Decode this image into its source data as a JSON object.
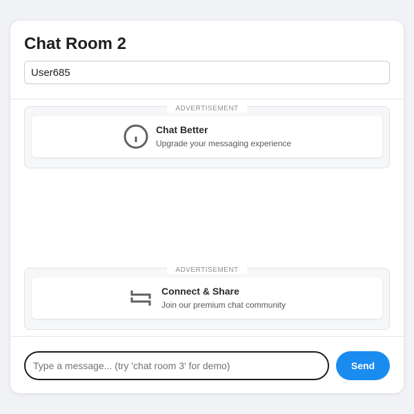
{
  "header": {
    "title": "Chat Room 2",
    "username_value": "User685"
  },
  "ads": [
    {
      "tag": "ADVERTISEMENT",
      "icon": "info-circle-icon",
      "title": "Chat Better",
      "subtitle": "Upgrade your messaging experience"
    },
    {
      "tag": "ADVERTISEMENT",
      "icon": "share-arrows-icon",
      "title": "Connect & Share",
      "subtitle": "Join our premium chat community"
    }
  ],
  "composer": {
    "placeholder": "Type a message... (try 'chat room 3' for demo)",
    "send_label": "Send"
  },
  "colors": {
    "accent": "#1a8cf0",
    "background": "#f1f2f6"
  }
}
